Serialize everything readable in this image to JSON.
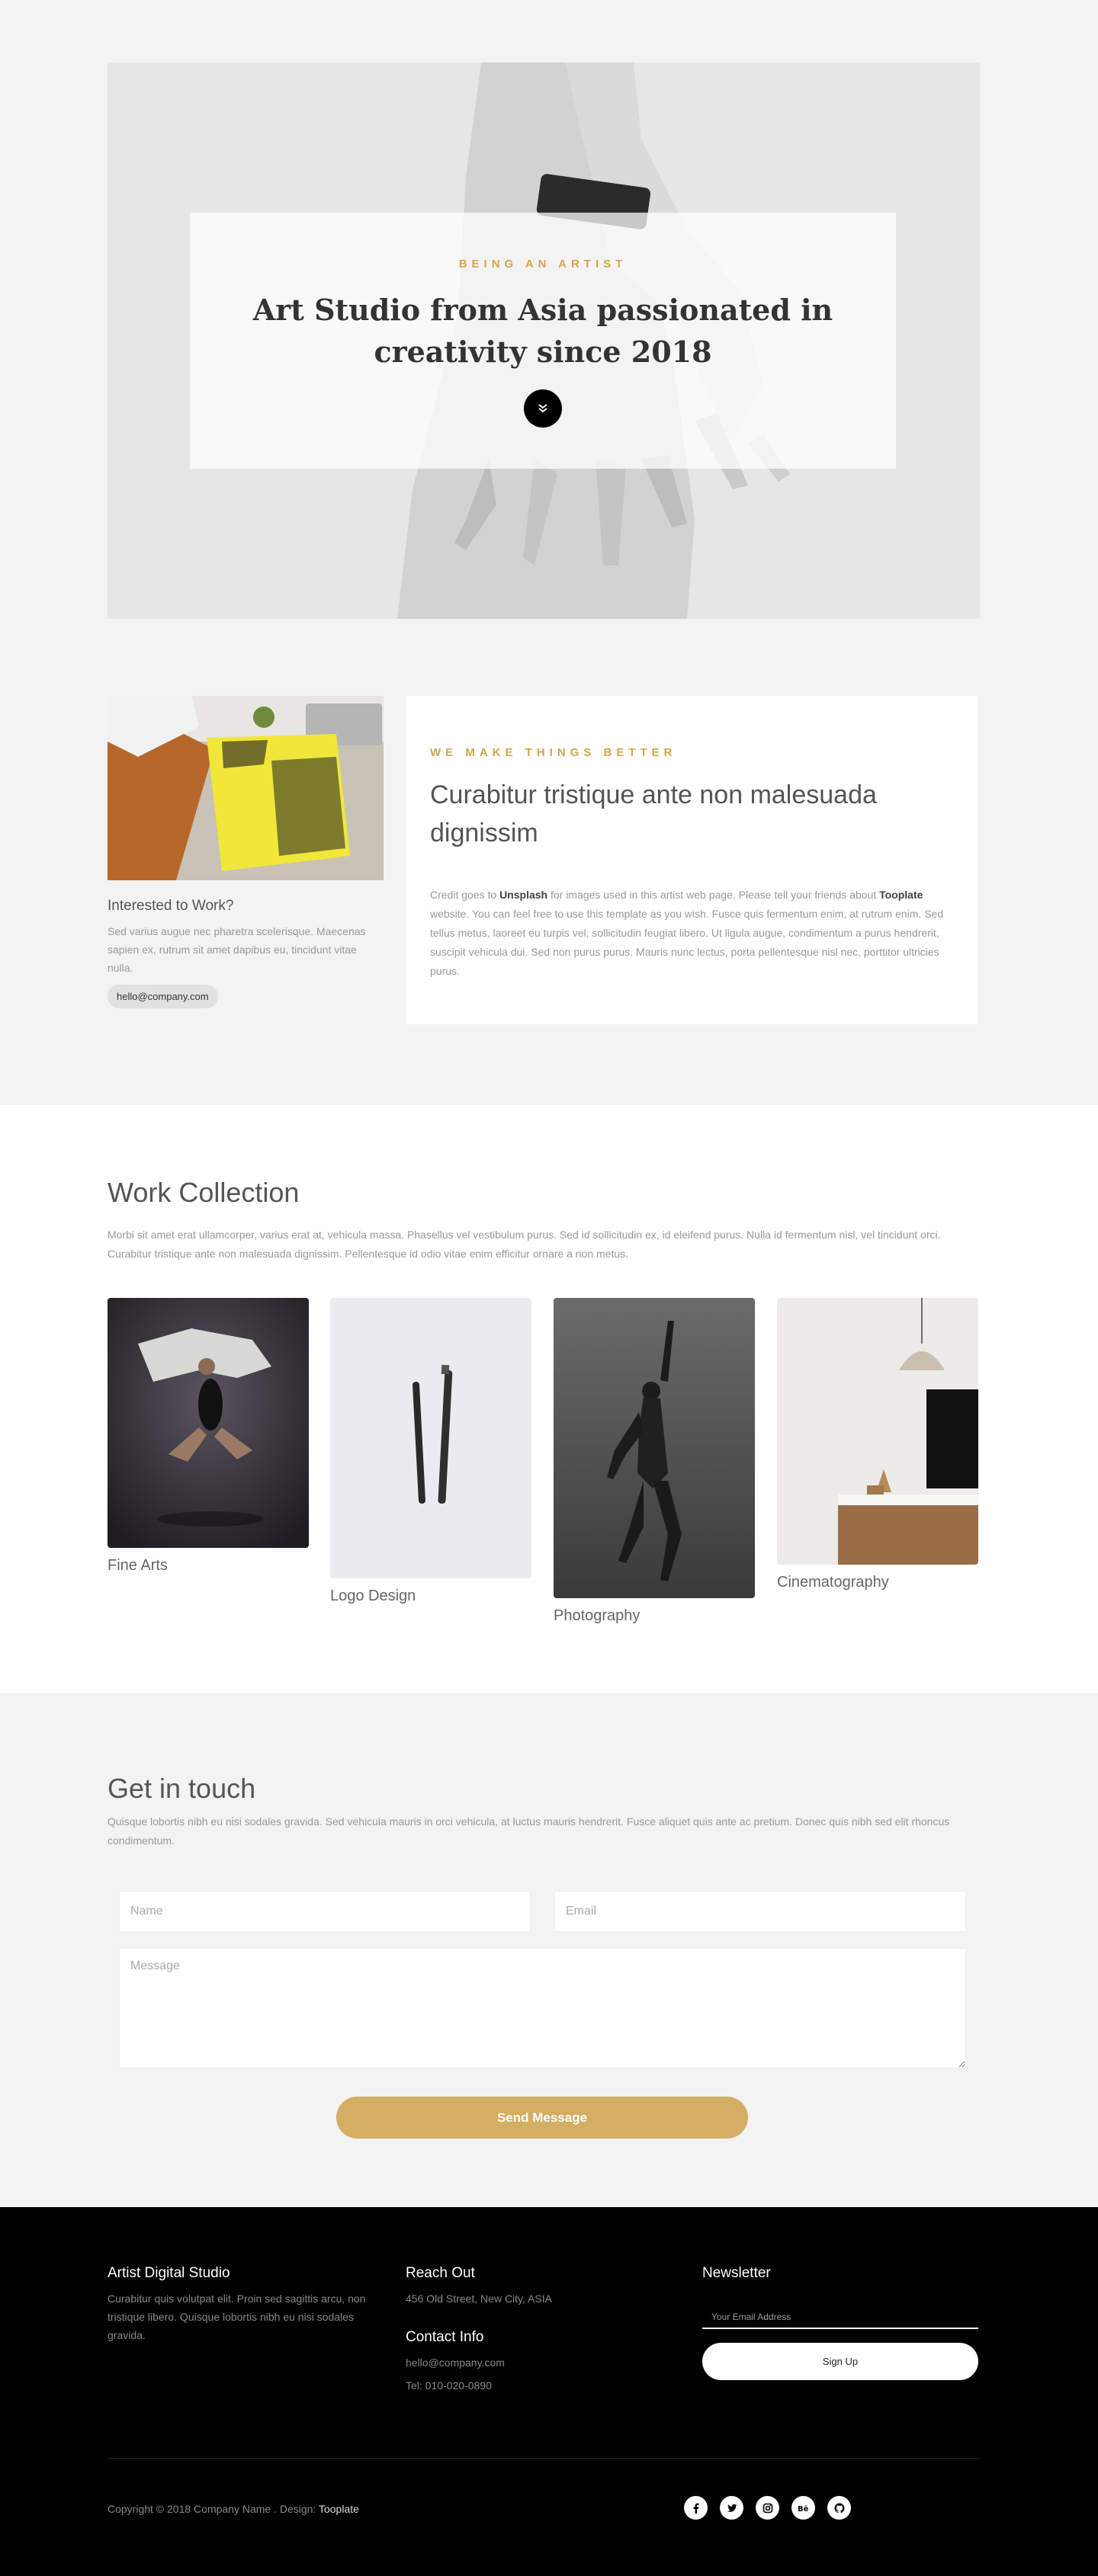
{
  "hero": {
    "eyebrow": "Being an artist",
    "title": "Art Studio from Asia passionated in creativity since 2018",
    "scroll_icon": "double-chevron-down-icon"
  },
  "intro": {
    "work_heading": "Interested to Work?",
    "work_text": "Sed varius augue nec pharetra scelerisque. Maecenas sapien ex, rutrum sit amet dapibus eu, tincidunt vitae nulla.",
    "email_pill": "hello@company.com",
    "eyebrow": "We make things better",
    "heading": "Curabitur tristique ante non malesuada dignissim",
    "body_1": "Credit goes to ",
    "body_link_1": "Unsplash",
    "body_2": " for images used in this artist web page. Please tell your friends about ",
    "body_link_2": "Tooplate",
    "body_3": " website. You can feel free to use this template as you wish. Fusce quis fermentum enim, at rutrum enim. Sed tellus metus, laoreet eu turpis vel, sollicitudin feugiat libero. Ut ligula augue, condimentum a purus hendrerit, suscipit vehicula dui. Sed non purus purus. Mauris nunc lectus, porta pellentesque nisl nec, porttitor ultricies purus."
  },
  "work": {
    "title": "Work Collection",
    "lead": "Morbi sit amet erat ullamcorper, varius erat at, vehicula massa. Phasellus vel vestibulum purus. Sed id sollicitudin ex, id eleifend purus. Nulla id fermentum nisl, vel tincidunt orci. Curabitur tristique ante non malesuada dignissim. Pellentesque id odio vitae enim efficitur ornare a non metus.",
    "items": [
      {
        "label": "Fine Arts"
      },
      {
        "label": "Logo Design"
      },
      {
        "label": "Photography"
      },
      {
        "label": "Cinematography"
      }
    ]
  },
  "contact": {
    "title": "Get in touch",
    "lead": "Quisque lobortis nibh eu nisi sodales gravida. Sed vehicula mauris in orci vehicula, at luctus mauris hendrerit. Fusce aliquet quis ante ac pretium. Donec quis nibh sed elit rhoncus condimentum.",
    "name_placeholder": "Name",
    "email_placeholder": "Email",
    "message_placeholder": "Message",
    "send_label": "Send Message",
    "accent_color": "#d4ae62"
  },
  "footer": {
    "brand_heading": "Artist Digital Studio",
    "brand_text": "Curabitur quis volutpat elit. Proin sed sagittis arcu, non tristique libero. Quisque lobortis nibh eu nisi sodales gravida.",
    "reach_heading": "Reach Out",
    "address": "456 Old Street, New City, ASIA",
    "contact_heading": "Contact Info",
    "email": "hello@company.com",
    "phone": "Tel: 010-020-0890",
    "newsletter_heading": "Newsletter",
    "newsletter_placeholder": "Your Email Address",
    "signup_label": "Sign Up",
    "copyright": "Copyright © 2018 Company Name . Design: ",
    "design_link": "Tooplate",
    "social_icons": [
      "facebook-icon",
      "twitter-icon",
      "instagram-icon",
      "behance-icon",
      "github-icon"
    ]
  }
}
